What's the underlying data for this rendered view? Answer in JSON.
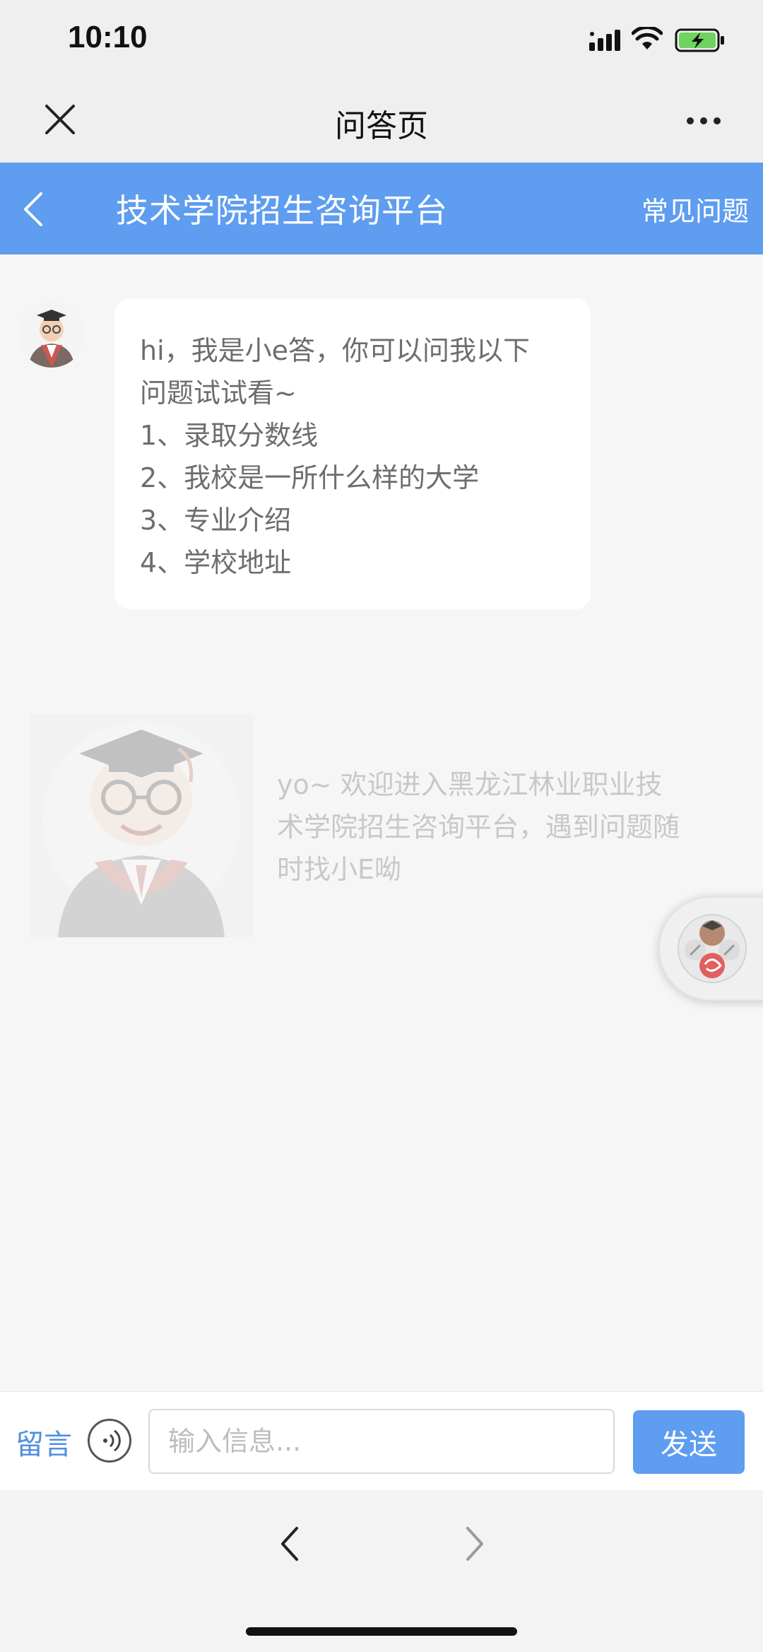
{
  "status_bar": {
    "time": "10:10",
    "icons": [
      "signal-icon",
      "wifi-icon",
      "battery-charging-icon"
    ]
  },
  "nav_bar": {
    "title": "问答页",
    "close_icon": "close-icon",
    "more_icon": "more-icon"
  },
  "header": {
    "title": "技术学院招生咨询平台",
    "faq_label": "常见问题",
    "back_icon": "chevron-left-icon",
    "background_color": "#5e9df0"
  },
  "chat": {
    "bot_message_lines": [
      "hi，我是小e答，你可以问我以下",
      "问题试试看~",
      "1、录取分数线",
      "2、我校是一所什么样的大学",
      "3、专业介绍",
      "4、学校地址"
    ]
  },
  "welcome_watermark": {
    "lines": [
      "yo~     欢迎进入黑龙江林业职业技",
      "术学院招生咨询平台，遇到问题随",
      "时找小E呦"
    ]
  },
  "input_bar": {
    "leave_message_label": "留言",
    "voice_icon": "voice-icon",
    "placeholder": "输入信息...",
    "value": "",
    "send_label": "发送"
  },
  "bottom_toolbar": {
    "back_icon": "chevron-left-icon",
    "forward_icon": "chevron-right-icon"
  },
  "colors": {
    "accent": "#5e9df0",
    "link": "#4f8fe0",
    "background": "#f6f6f6"
  }
}
